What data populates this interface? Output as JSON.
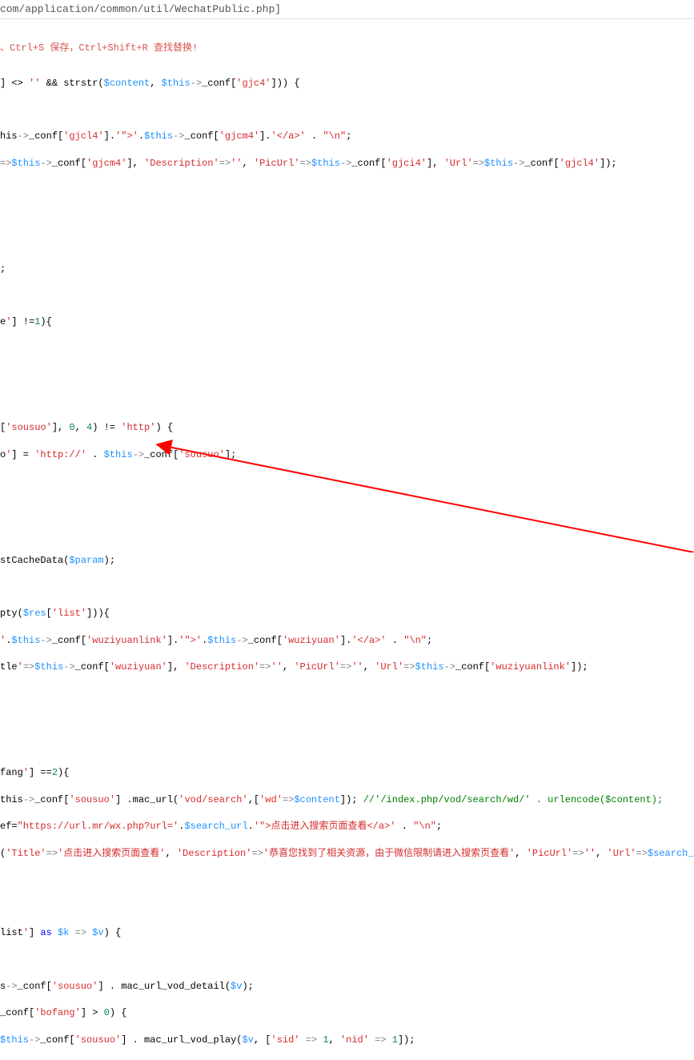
{
  "header": {
    "path": "com/application/common/util/WechatPublic.php]"
  },
  "hint": "、Ctrl+S 保存，Ctrl+Shift+R 查找替换!",
  "code": {
    "l1": "] <> '' && strstr($content, $this->_conf['gjc4'])) {",
    "l2": "",
    "l3": "his->_conf['gjcl4'].'\">'.$this->_conf['gjcm4'].'</a>' . \"\\n\";",
    "l4": "=>$this->_conf['gjcm4'], 'Description'=>'', 'PicUrl'=>$this->_conf['gjci4'], 'Url'=>$this->_conf['gjcl4']);",
    "l5": "",
    "l6": "",
    "l7": ";",
    "l8": "",
    "l9": "e'] !=1){",
    "l10": "",
    "l11": "",
    "l12": "['sousuo'], 0, 4) != 'http') {",
    "l13": "o'] = 'http://' . $this->_conf['sousuo'];",
    "l14": "",
    "l15": "",
    "l16": "stCacheData($param);",
    "l17": "",
    "l18": "pty($res['list'])){",
    "l19": "'.$this->_conf['wuziyuanlink'].'\">'.$this->_conf['wuziyuan'].'</a>' . \"\\n\";",
    "l20": "tle'=>$this->_conf['wuziyuan'], 'Description'=>'', 'PicUrl'=>'', 'Url'=>$this->_conf['wuziyuanlink']);",
    "l21": "",
    "l22": "",
    "l23": "fang'] ==2){",
    "l24": "this->_conf['sousuo'] .mac_url('vod/search',['wd'=>$content]); //'/index.php/vod/search/wd/' . urlencode($content);",
    "l25": "ef=\"https://url.mr/wx.php?url='.$search_url.'\">点击进入搜索页面查看</a>' . \"\\n\";",
    "l26": "('Title'=>'点击进入搜索页面查看', 'Description'=>'恭喜您找到了相关资源，由于微信限制请进入搜索页查看', 'PicUrl'=>'', 'Url'=>$search_url );",
    "l27": "",
    "l28": "",
    "l29": "list'] as $k => $v) {",
    "l30": "",
    "l31": "s->_conf['sousuo'] . mac_url_vod_detail($v);",
    "l32": "_conf['bofang'] > 0) {",
    "l33": "$this->_conf['sousuo'] . mac_url_vod_play($v, ['sid' => 1, 'nid' => 1]);"
  },
  "annotation": {
    "color": "#ff0000"
  }
}
